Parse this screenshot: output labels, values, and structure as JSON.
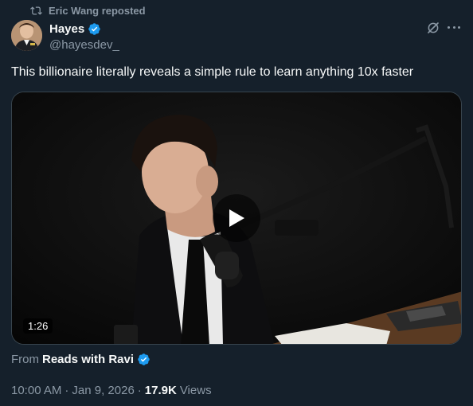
{
  "repost": {
    "text": "Eric Wang reposted",
    "icon": "repost-icon"
  },
  "author": {
    "display_name": "Hayes",
    "handle": "@hayesdev_",
    "verified": true,
    "verified_color": "#1d9bf0"
  },
  "header_actions": {
    "grok_icon": "grok-icon",
    "more_icon": "more-icon"
  },
  "tweet": {
    "text": "This billionaire literally reveals a simple rule to learn anything 10x faster"
  },
  "media": {
    "type": "video",
    "duration": "1:26",
    "play_icon": "play-icon"
  },
  "source": {
    "prefix": "From",
    "name": "Reads with Ravi",
    "verified": true
  },
  "meta": {
    "time": "10:00 AM",
    "separator1": "·",
    "date": "Jan 9, 2026",
    "separator2": "·",
    "views_count": "17.9K",
    "views_label": "Views"
  },
  "colors": {
    "background": "#15202b",
    "text_primary": "#f7f9f9",
    "text_secondary": "#8b98a5",
    "accent": "#1d9bf0"
  }
}
